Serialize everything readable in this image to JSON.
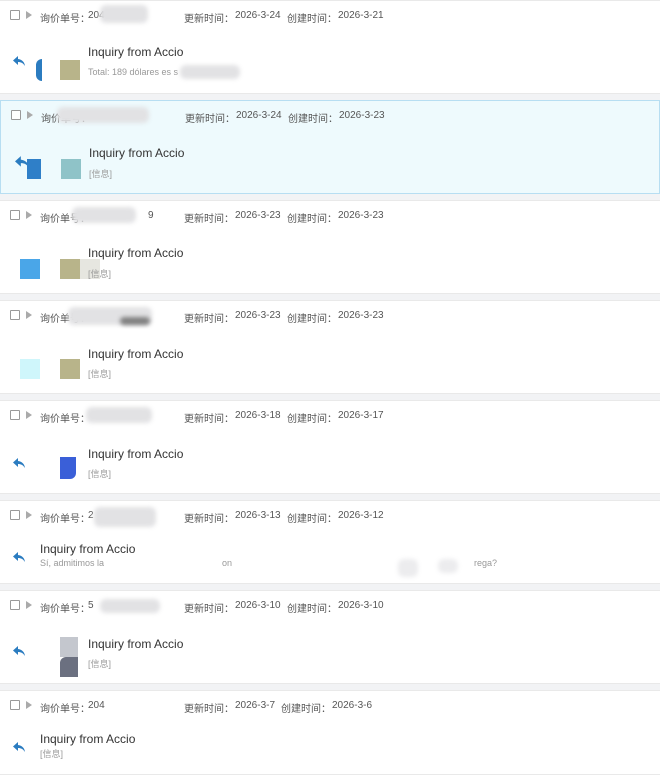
{
  "labels": {
    "inquiry_no": "询价单号：",
    "updated": "更新时间：",
    "created": "创建时间："
  },
  "items": [
    {
      "inq": "204",
      "updated": "2026-3-24",
      "created": "2026-3-21",
      "title": "Inquiry from Accio",
      "subtitle": "Total: 189 dólares es                       s",
      "selected": false
    },
    {
      "inq": "",
      "updated": "2026-3-24",
      "created": "2026-3-23",
      "title": "Inquiry from Accio",
      "subtitle": "[信息]",
      "selected": true
    },
    {
      "inq": "9",
      "updated": "2026-3-23",
      "created": "2026-3-23",
      "title": "Inquiry from Accio",
      "subtitle": "[信息]",
      "selected": false
    },
    {
      "inq": "",
      "updated": "2026-3-23",
      "created": "2026-3-23",
      "title": "Inquiry from Accio",
      "subtitle": "[信息]",
      "selected": false
    },
    {
      "inq": "",
      "updated": "2026-3-18",
      "created": "2026-3-17",
      "title": "Inquiry from Accio",
      "subtitle": "[信息]",
      "selected": false
    },
    {
      "inq": "2",
      "updated": "2026-3-13",
      "created": "2026-3-12",
      "title": "Inquiry from Accio",
      "subtitle": "Sí, admitimos la",
      "subtitle_mid": "on",
      "subtitle_tail": "rega?",
      "selected": false
    },
    {
      "inq": "5",
      "updated": "2026-3-10",
      "created": "2026-3-10",
      "title": "Inquiry from Accio",
      "subtitle": "[信息]",
      "selected": false
    },
    {
      "inq": "204",
      "updated": "2026-3-7",
      "created": "2026-3-6",
      "title": "Inquiry from Accio",
      "subtitle": "[信息]",
      "selected": false
    }
  ],
  "colors": {
    "reply_icon": "#2b7cc0",
    "thumb_olive": "#b8b48a",
    "thumb_teal": "#8fc3c8",
    "thumb_blue": "#2f6de0",
    "thumb_gray": "#6b7080"
  }
}
